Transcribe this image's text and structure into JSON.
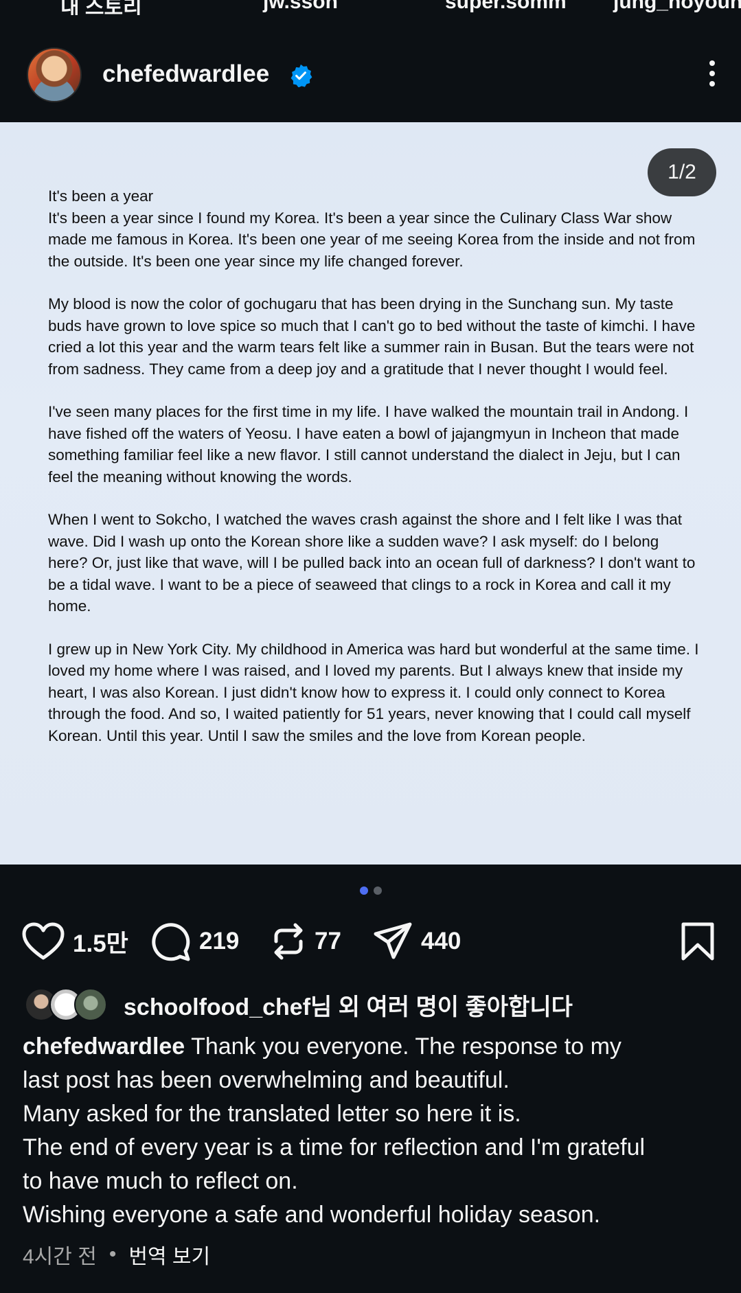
{
  "stories": [
    "내 스토리",
    "jw.sson",
    "super.somm",
    "jung_hoyoun"
  ],
  "post": {
    "username": "chefedwardlee",
    "verified": true,
    "photo_counter": "1/2",
    "letter": [
      "It's been a year",
      "It's been a year since I found my Korea.  It's been a year since the Culinary Class War show made me famous in Korea.  It's been one year of me seeing Korea from the inside and not from the outside.  It's been one year since my life changed forever.",
      "My blood is now the color of gochugaru that has been drying in the Sunchang sun.  My taste buds have grown to love spice so much that I can't go to bed without the taste of kimchi.  I have cried a lot this year and the warm tears felt like a summer rain in Busan.  But the tears were not from sadness.  They came from a deep joy and a gratitude that I never thought I would feel.",
      "I've seen many places for the first time in my life.  I have walked the mountain trail in Andong.  I have fished off the waters of Yeosu.  I have eaten a bowl of jajangmyun in Incheon that made something familiar feel like a new flavor.  I still cannot understand the dialect in Jeju, but I can feel the meaning without knowing the words.",
      "When I went to Sokcho, I watched the waves crash against the shore and I felt like I was that wave. Did I wash up onto the Korean shore like a sudden wave?   I ask myself: do I belong here?  Or, just like that wave, will I be pulled back into an ocean full of darkness?  I don't want to be a tidal wave.  I want to be a piece of seaweed that clings to a rock in Korea and call it my home.",
      "I grew up in New York City.  My childhood in America was hard but wonderful at the same time.  I loved my home where I was raised, and I loved my parents.  But I always knew that inside my heart, I was also Korean.  I just didn't know how to express it.  I could only connect to Korea through the food.  And so, I waited patiently for 51 years, never knowing that I could call myself Korean.  Until this year.  Until I saw the smiles and the love from Korean people."
    ],
    "carousel_total": 2,
    "carousel_active": 1
  },
  "actions": {
    "likes": "1.5만",
    "comments": "219",
    "reposts": "77",
    "shares": "440"
  },
  "liked_by": "schoolfood_chef님 외 여러 명이 좋아합니다",
  "caption": {
    "username": "chefedwardlee",
    "lines": [
      "Thank you everyone. The response to my",
      "last post has been overwhelming and beautiful.",
      "Many asked for the translated letter so here it is.",
      "The end of every year is a time for reflection and I'm grateful",
      "to have much to reflect on.",
      "Wishing everyone a safe and wonderful holiday season."
    ]
  },
  "meta": {
    "time_ago": "4시간 전",
    "separator": "•",
    "translate_label": "번역 보기"
  },
  "colors": {
    "background": "#0c1014",
    "verified_badge": "#0095f6",
    "active_dot": "#4e6ef2"
  },
  "icons": [
    "heart-icon",
    "comment-icon",
    "repost-icon",
    "share-icon",
    "bookmark-icon",
    "more-icon",
    "verified-icon"
  ]
}
